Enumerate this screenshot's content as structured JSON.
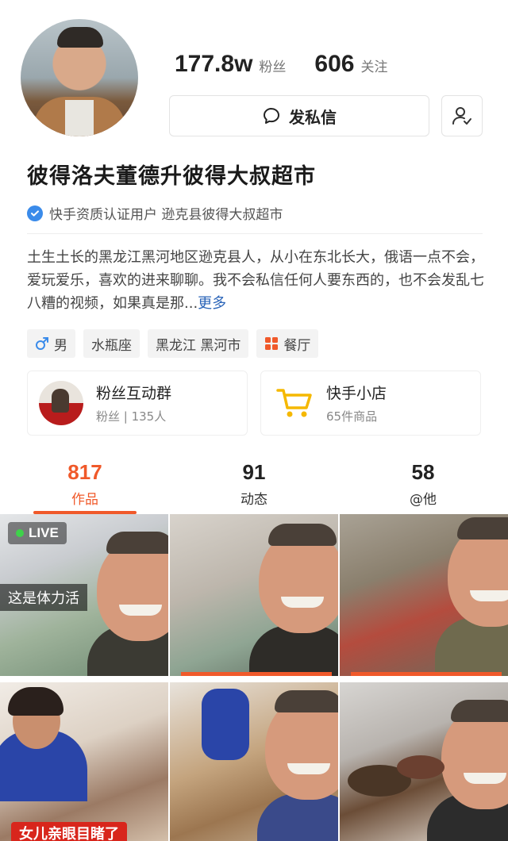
{
  "profile": {
    "fans_count": "177.8w",
    "fans_label": "粉丝",
    "following_count": "606",
    "following_label": "关注",
    "message_label": "发私信",
    "name": "彼得洛夫董德升彼得大叔超市",
    "verify_text": "快手资质认证用户 逊克县彼得大叔超市",
    "bio": "土生土长的黑龙江黑河地区逊克县人，从小在东北长大，俄语一点不会，爱玩爱乐，喜欢的进来聊聊。我不会私信任何人要东西的，也不会发乱七八糟的视频，如果真是那...",
    "bio_more": "更多"
  },
  "tags": [
    {
      "icon": "male-icon",
      "label": "男"
    },
    {
      "icon": "",
      "label": "水瓶座"
    },
    {
      "icon": "",
      "label": "黑龙江 黑河市"
    },
    {
      "icon": "grid-icon",
      "label": "餐厅"
    }
  ],
  "cards": {
    "fan_group": {
      "title": "粉丝互动群",
      "subtitle": "粉丝 | 135人"
    },
    "shop": {
      "title": "快手小店",
      "subtitle": "65件商品"
    }
  },
  "tabs": [
    {
      "count": "817",
      "label": "作品"
    },
    {
      "count": "91",
      "label": "动态"
    },
    {
      "count": "58",
      "label": "@他"
    }
  ],
  "grid": {
    "live_label": "LIVE",
    "caption_1": "这是体力活",
    "caption_4": "女儿亲眼目睹了"
  },
  "colors": {
    "accent": "#f0592a",
    "verify_blue": "#3a8bea",
    "link_blue": "#2a64b8",
    "cart_yellow": "#f5b800"
  }
}
